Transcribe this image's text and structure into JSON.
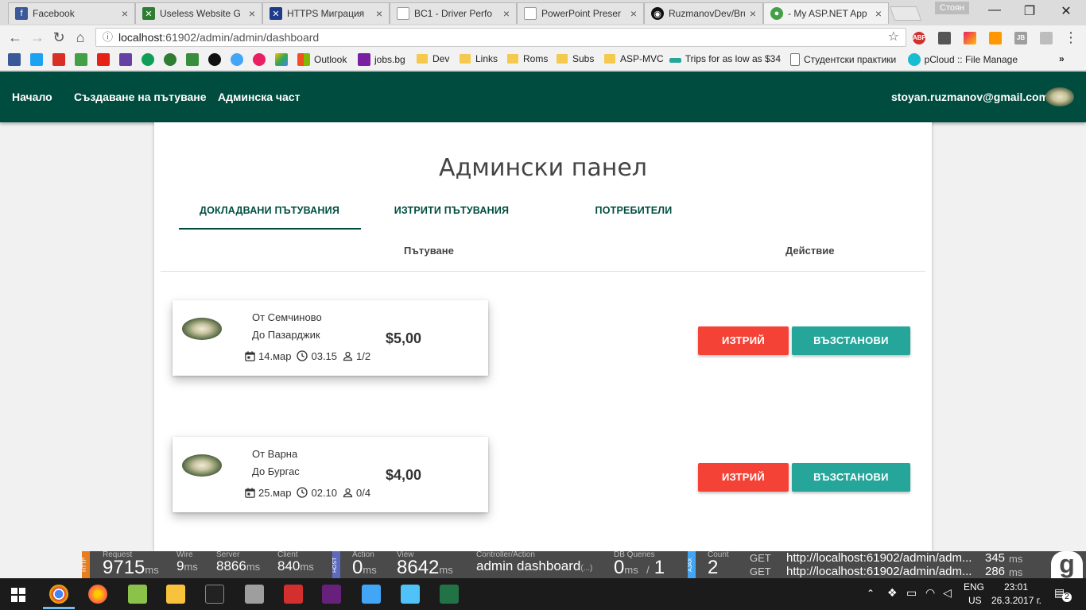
{
  "browser": {
    "tabs": [
      {
        "title": "Facebook",
        "color": "#3b5998",
        "glyph": "f"
      },
      {
        "title": "Useless Website G",
        "color": "#2e7d32",
        "glyph": "✕"
      },
      {
        "title": "HTTPS Миграция",
        "color": "#1e3a8a",
        "glyph": "✕"
      },
      {
        "title": "BC1 - Driver Perfo",
        "color": "#ffffff",
        "glyph": ""
      },
      {
        "title": "PowerPoint Preser",
        "color": "#ffffff",
        "glyph": ""
      },
      {
        "title": "RuzmanovDev/Bru",
        "color": "#111111",
        "glyph": "◉"
      },
      {
        "title": "- My ASP.NET App",
        "color": "#43a047",
        "glyph": "●"
      }
    ],
    "profile_name": "Стоян",
    "url_host": "localhost",
    "url_rest": ":61902/admin/admin/dashboard",
    "bookmarks": [
      {
        "label": "Outlook",
        "type": "icon",
        "color": "#0078d4"
      },
      {
        "label": "jobs.bg",
        "type": "icon",
        "color": "#7b1fa2"
      },
      {
        "label": "Dev",
        "type": "folder"
      },
      {
        "label": "Links",
        "type": "folder"
      },
      {
        "label": "Roms",
        "type": "folder"
      },
      {
        "label": "Subs",
        "type": "folder"
      },
      {
        "label": "ASP-MVC",
        "type": "folder"
      },
      {
        "label": "Trips for as low as $34",
        "type": "icon",
        "color": "#26a69a"
      },
      {
        "label": "Студентски практики",
        "type": "page"
      },
      {
        "label": "pCloud :: File Manage",
        "type": "icon",
        "color": "#17bed0"
      }
    ]
  },
  "nav": {
    "home": "Начало",
    "create_trip": "Създаване на пътуване",
    "admin": "Админска част",
    "user_email": "stoyan.ruzmanov@gmail.com"
  },
  "page": {
    "title": "Админски панел",
    "tabs": [
      "ДОКЛАДВАНИ ПЪТУВАНИЯ",
      "ИЗТРИТИ ПЪТУВАНИЯ",
      "ПОТРЕБИТЕЛИ"
    ],
    "active_tab": 0,
    "col_trip": "Пътуване",
    "col_action": "Действие"
  },
  "trips": [
    {
      "from": "От Семчиново",
      "to": "До Пазарджик",
      "price": "$5,00",
      "date": "14.мар",
      "time": "03.15",
      "seats": "1/2",
      "delete_label": "ИЗТРИЙ",
      "restore_label": "ВЪЗСТАНОВИ"
    },
    {
      "from": "От Варна",
      "to": "До Бургас",
      "price": "$4,00",
      "date": "25.мар",
      "time": "02.10",
      "seats": "0/4",
      "delete_label": "ИЗТРИЙ",
      "restore_label": "ВЪЗСТАНОВИ"
    }
  ],
  "glimpse": {
    "http_tag": "HTTP",
    "host_tag": "HOST",
    "ajax_tag": "AJAX",
    "request": {
      "label": "Request",
      "value": "9715",
      "unit": "ms"
    },
    "wire": {
      "label": "Wire",
      "value": "9",
      "unit": "ms"
    },
    "server": {
      "label": "Server",
      "value": "8866",
      "unit": "ms"
    },
    "client": {
      "label": "Client",
      "value": "840",
      "unit": "ms"
    },
    "action": {
      "label": "Action",
      "value": "0",
      "unit": "ms"
    },
    "view": {
      "label": "View",
      "value": "8642",
      "unit": "ms"
    },
    "controller_action": {
      "label": "Controller/Action",
      "value": "admin dashboard",
      "suffix": "(...)"
    },
    "db": {
      "label": "DB Queries",
      "value": "0",
      "unit": "ms",
      "sep": "/",
      "count": "1"
    },
    "count": {
      "label": "Count",
      "value": "2"
    },
    "ajax": [
      {
        "method": "GET",
        "url": "http://localhost:61902/admin/adm...",
        "time": "345",
        "unit": "ms"
      },
      {
        "method": "GET",
        "url": "http://localhost:61902/admin/adm...",
        "time": "286",
        "unit": "ms"
      }
    ]
  },
  "taskbar": {
    "lang": "ENG",
    "region": "US",
    "time": "23:01",
    "date": "26.3.2017 г.",
    "notifications": "2"
  }
}
